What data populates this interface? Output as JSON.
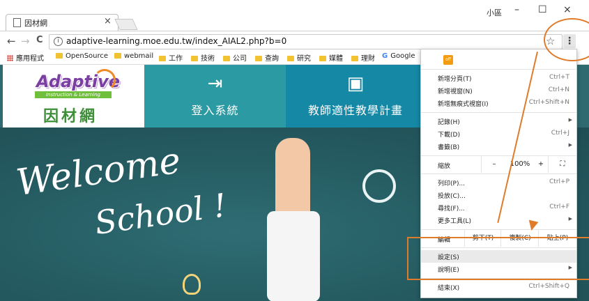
{
  "browser": {
    "tab": {
      "title": "因材網",
      "close": "×"
    },
    "profile": "小區",
    "window": {
      "minimize": "–",
      "maximize": "☐",
      "close": "×"
    },
    "nav": {
      "back": "←",
      "forward": "→",
      "reload": "C"
    },
    "url": "adaptive-learning.moe.edu.tw/index_AIAL2.php?b=0",
    "info_icon": "i",
    "star": "☆",
    "menu_button": "⋮"
  },
  "bookmarks": [
    {
      "label": "應用程式",
      "type": "apps"
    },
    {
      "label": "OpenSource",
      "type": "folder"
    },
    {
      "label": "webmail",
      "type": "folder"
    },
    {
      "label": "工作",
      "type": "folder"
    },
    {
      "label": "技術",
      "type": "folder"
    },
    {
      "label": "公司",
      "type": "folder"
    },
    {
      "label": "查詢",
      "type": "folder"
    },
    {
      "label": "研究",
      "type": "folder"
    },
    {
      "label": "媒體",
      "type": "folder"
    },
    {
      "label": "理財",
      "type": "folder"
    },
    {
      "label": "Google",
      "type": "google"
    }
  ],
  "site": {
    "logo_main": "Adaptive",
    "logo_sub": "Instruction & Learning",
    "logo_cn": "因材網",
    "nav_login": {
      "icon": "⇥",
      "label": "登入系統"
    },
    "nav_plan": {
      "icon": "▣",
      "label": "教師適性教學計畫"
    },
    "hero_line1": "Welcome",
    "hero_line2": "School !"
  },
  "menu": {
    "ext_badge": "off",
    "items": [
      {
        "label": "新增分頁(T)",
        "shortcut": "Ctrl+T"
      },
      {
        "label": "新增視窗(N)",
        "shortcut": "Ctrl+N"
      },
      {
        "label": "新增無痕式視窗(I)",
        "shortcut": "Ctrl+Shift+N"
      },
      {
        "label": "記錄(H)",
        "shortcut": "",
        "submenu": true
      },
      {
        "label": "下載(D)",
        "shortcut": "Ctrl+J"
      },
      {
        "label": "書籤(B)",
        "shortcut": "",
        "submenu": true
      }
    ],
    "zoom": {
      "label": "縮放",
      "minus": "–",
      "value": "100%",
      "plus": "+",
      "fullscreen": "⛶"
    },
    "items2": [
      {
        "label": "列印(P)...",
        "shortcut": "Ctrl+P"
      },
      {
        "label": "投放(C)...",
        "shortcut": ""
      },
      {
        "label": "尋找(F)...",
        "shortcut": "Ctrl+F"
      },
      {
        "label": "更多工具(L)",
        "shortcut": "",
        "submenu": true
      }
    ],
    "edit": {
      "label": "編輯",
      "cut": "剪下(T)",
      "copy": "複製(C)",
      "paste": "貼上(P)"
    },
    "settings": "設定(S)",
    "help": "說明(E)",
    "exit": "結束(X)",
    "exit_shortcut": "Ctrl+Shift+Q",
    "arrow": "▶"
  },
  "colors": {
    "annotation": "#e07b2a",
    "login_bg": "#2c9aa2",
    "plan_bg": "#1588a6"
  }
}
